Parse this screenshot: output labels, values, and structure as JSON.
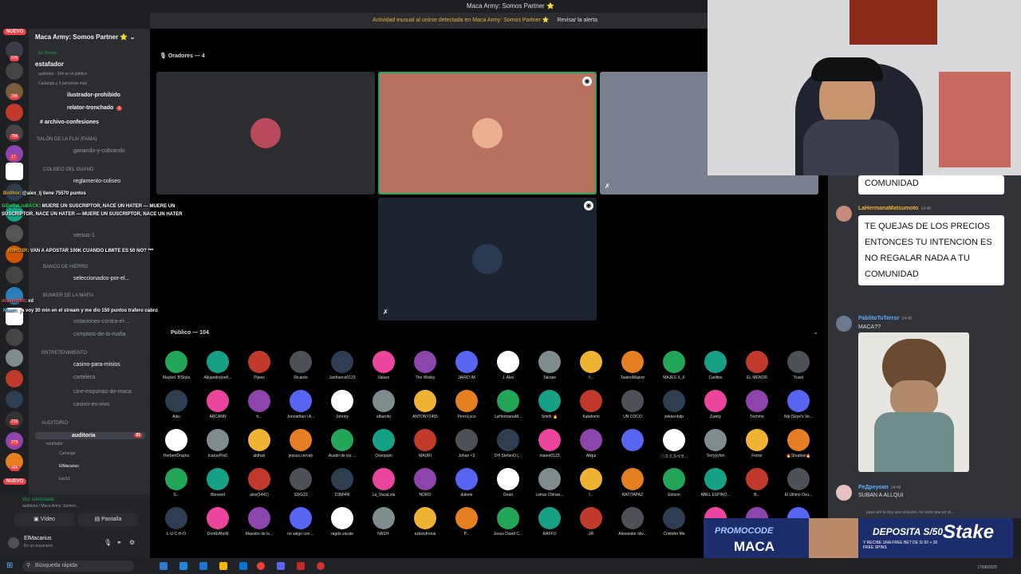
{
  "window_title": "Maca Army: Somos Partner ⭐",
  "alert": {
    "text": "Actividad inusual al unirse detectada en Maca Army: Somos Partner ⭐",
    "button": "Revisar la alerta"
  },
  "rail": {
    "new_badge": "NUEVO",
    "new_badge_bottom": "NUEVO",
    "badges": [
      "570",
      "296",
      "786",
      "17",
      "4",
      "290",
      "219",
      "279",
      "40K"
    ]
  },
  "sidebar": {
    "server_name": "Maca Army: Somos Partner ⭐",
    "live_label": "En Directo",
    "stage_name": "estafador",
    "stage_info": "auditoria · 104 en el público",
    "stage_info2": "Carlanga y 3 personas más",
    "channels": [
      {
        "label": "ilustrador-prohibido"
      },
      {
        "label": "relator-tronchado",
        "badge": "1"
      },
      {
        "label": "archivo-confesiones"
      }
    ],
    "cat_salon": "SALÓN DE LA FLA! (FAMA)",
    "ch_ganando": "ganando-y-cobrando",
    "cat_coliseo": "COLISEO DEL GUANO",
    "ch_reglamento": "reglamento-coliseo",
    "ch_versus": "versus-1",
    "cat_banco": "BANCO DE HIERRO",
    "ch_seleccionados": "seleccionados-por-el...",
    "cat_bunker": "BÚNKER DE LA MAFIA",
    "ch_votaciones": "votaciones-contra-el-...",
    "ch_complots": "complots-de-la-mafia",
    "cat_entretenimiento": "ENTRETENIMIENTO",
    "ch_casino": "casino-para-misios",
    "ch_cartelera": "cartelera",
    "ch_cine": "cine-esquinas-de-maca",
    "ch_casino_vivo": "casino-en-vivo",
    "cat_auditorio": "AUDITORIO",
    "ch_auditoria": "auditoria",
    "ch_auditoria_badge": "81",
    "ch_auditoria_sub": "estafador",
    "voice_members": [
      "Carlanga",
      "ElMacarius",
      "luisS3"
    ]
  },
  "voice_panel": {
    "connected": "Voz conectada",
    "channel": "auditoria / Maca Army: Somos...",
    "video": "Vídeo",
    "screen": "Pantalla",
    "user": "ElMacarius",
    "status": "En un escenario"
  },
  "overlay_chat": [
    {
      "user": "Bolthix",
      "text": ": @alex_lj tiene 75570 puntos"
    },
    {
      "user": "SiDeRaLisBACK",
      "text": ": MUERE UN SUSCRIPTOR, NACE UN HATER — MUERE UN SUSCRIPTOR, NACE UN HATER — MUERE UN SUSCRIPTOR, NACE UN HATER"
    },
    {
      "user": "R0RO3R",
      "text": ": VAN A APOSTAR 100K CUANDO LIMITE ES 50 NO? ***"
    },
    {
      "user": "drakell666",
      "text": ": xd"
    },
    {
      "user": "Mauri",
      "text": ": ya voy 30 min en el stream y me dio 150 puntos trafero cabro"
    }
  ],
  "speakers": {
    "title": "Oradores — 4"
  },
  "audience": {
    "title": "Público — 104",
    "members": [
      "Maykel. B'Styla",
      "Alejandro(señ...",
      "Pijees",
      "Ricardo",
      "Janfranco0123",
      "Valuxx",
      "The Wisley",
      "JAIRO IM",
      "J. Alex",
      "Takope",
      "f...",
      "TaatooMajoor",
      "MAJES X_X",
      "Carlitos",
      "EL MENOR",
      "Yusel",
      "Aiko",
      "ARCANN",
      "h...",
      "Jonnathan I A...",
      "Johnny",
      "elburrito",
      "ANTONY2455",
      "PerroLoco",
      "LaHermanaM...",
      "Smith 🔥",
      "Katahomi",
      "UN COCO",
      "zekkenhdp",
      "Zarely",
      "Tochme",
      "Niji (Skye's Ve...",
      "HerbertDracks",
      "IcarusPro0",
      "aldhair",
      "jessus.cervan",
      "Austin de los ...",
      "Ossopum",
      "MAURI",
      "Johan <3",
      "DH StefanO (...",
      "mateo0123",
      "Allqui",
      "　",
      "◇スミスペラ...",
      "Terryyyhm",
      "Ferrer",
      "🔥Shadow🔥",
      "S...",
      "Blessed",
      "alex(1441)",
      "S3rG10",
      "D3MI4N",
      "La_VacaLoia",
      "NORO",
      "dukete",
      "Gean",
      "Letras Chinas...",
      "I...",
      "RATITAPAZ",
      "Edison",
      "ABEL ESPINO...",
      "B...",
      "El Ultimo Ovu...",
      "L-U-C-H-O",
      "DomEAhnN",
      "Maestro de lo...",
      "no salgo con ...",
      "ragde zarate",
      "NASH-",
      "ezkizofrenia",
      "P...",
      "Jesus David C...",
      "RAFFO",
      "JR",
      "Alexander oliv...",
      "Cristofer Me",
      "",
      "",
      ""
    ]
  },
  "chat": {
    "bubble1_tail": "COMUNIDAD",
    "msg2_user": "LaHermanaMatsumoto",
    "msg2_time": "14:48",
    "msg2_text": "TE QUEJAS DE LOS PRECIOS ENTONCES TU INTENCION ES NO REGALAR NADA A TU COMUNIDAD",
    "msg3_user": "PablitoTuTerror",
    "msg3_time": "14:48",
    "msg3_text": "MACA??",
    "msg4_user": "PeДреуоап",
    "msg4_time": "14:48",
    "msg4_text": "SUBAN A ALLQUI",
    "msg5_preview": "pues ahí te doy una solución, he visto que en ot..."
  },
  "promo": {
    "label": "PROMOCODE",
    "code": "MACA",
    "deposit": "DEPOSITA S/50",
    "line": "Y RECIBE UNA FREE BET DE S/ 50 + 30 FREE SPINS",
    "brand": "Stake"
  },
  "taskbar": {
    "search": "Búsqueda rápida",
    "date": "17/08/2025"
  }
}
